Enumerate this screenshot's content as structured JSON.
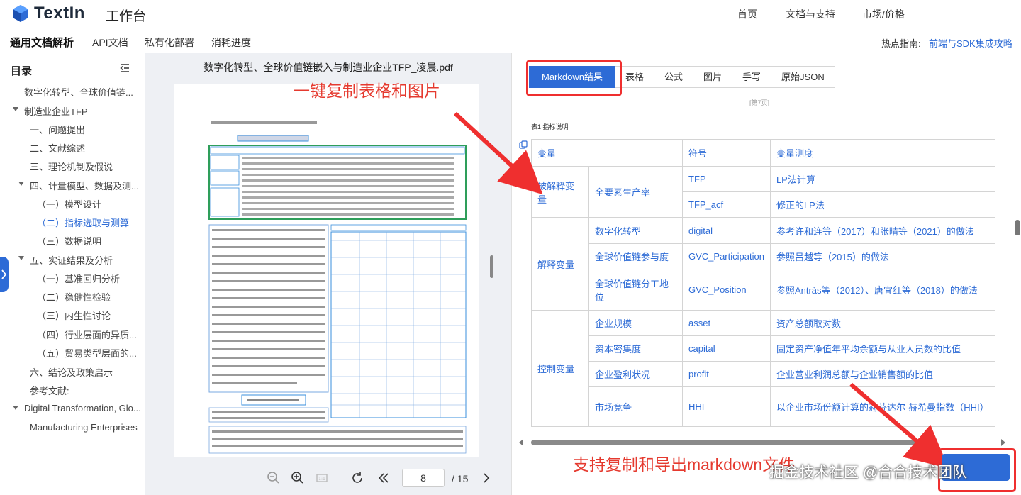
{
  "brand": {
    "name": "TextIn",
    "workbench": "工作台"
  },
  "topnav": {
    "home": "首页",
    "docs": "文档与支持",
    "market": "市场/价格"
  },
  "subnav": {
    "items": [
      "通用文档解析",
      "API文档",
      "私有化部署",
      "消耗进度"
    ],
    "hot_label": "热点指南:",
    "hot_link": "前端与SDK集成攻略"
  },
  "toc": {
    "title": "目录",
    "items": [
      {
        "label": "数字化转型、全球价值链..."
      },
      {
        "label": "制造业企业TFP"
      },
      {
        "label": "一、问题提出"
      },
      {
        "label": "二、文献综述"
      },
      {
        "label": "三、理论机制及假说"
      },
      {
        "label": "四、计量模型、数据及测..."
      },
      {
        "label": "（一）模型设计"
      },
      {
        "label": "（二）指标选取与测算"
      },
      {
        "label": "（三）数据说明"
      },
      {
        "label": "五、实证结果及分析"
      },
      {
        "label": "（一）基准回归分析"
      },
      {
        "label": "（二）稳健性检验"
      },
      {
        "label": "（三）内生性讨论"
      },
      {
        "label": "（四）行业层面的异质..."
      },
      {
        "label": "（五）贸易类型层面的..."
      },
      {
        "label": "六、结论及政策启示"
      },
      {
        "label": "参考文献:"
      },
      {
        "label": "Digital Transformation, Glo..."
      },
      {
        "label": "Manufacturing Enterprises"
      }
    ]
  },
  "pdf": {
    "filename": "数字化转型、全球价值链嵌入与制造业企业TFP_凌晨.pdf",
    "current_page": "8",
    "total_pages": "/ 15"
  },
  "result": {
    "tabs": [
      "Markdown结果",
      "表格",
      "公式",
      "图片",
      "手写",
      "原始JSON"
    ],
    "page_marker": "[第7页]",
    "table_caption": "表1 指标说明",
    "table": {
      "headers": [
        "变量",
        "符号",
        "变量测度"
      ],
      "rows": [
        {
          "group": "被解释变量",
          "name": "全要素生产率",
          "symbol": "TFP",
          "measure": "LP法计算"
        },
        {
          "symbol": "TFP_acf",
          "measure": "修正的LP法"
        },
        {
          "group": "解释变量",
          "name": "数字化转型",
          "symbol": "digital",
          "measure": "参考许和连等（2017）和张晴等（2021）的做法"
        },
        {
          "name": "全球价值链参与度",
          "symbol": "GVC_Participation",
          "measure": "参照吕越等（2015）的做法"
        },
        {
          "name": "全球价值链分工地位",
          "symbol": "GVC_Position",
          "measure": "参照Antràs等（2012）、唐宜红等（2018）的做法"
        },
        {
          "group": "控制变量",
          "name": "企业规模",
          "symbol": "asset",
          "measure": "资产总额取对数"
        },
        {
          "name": "资本密集度",
          "symbol": "capital",
          "measure": "固定资产净值年平均余额与从业人员数的比值"
        },
        {
          "name": "企业盈利状况",
          "symbol": "profit",
          "measure": "企业营业利润总额与企业销售额的比值"
        },
        {
          "name": "市场竞争",
          "symbol": "HHI",
          "measure": "以企业市场份额计算的赫芬达尔-赫希曼指数（HHI）"
        }
      ]
    }
  },
  "annotations": {
    "top": "一键复制表格和图片",
    "bottom": "支持复制和导出markdown文件"
  },
  "watermark": "掘金技术社区 @合合技术团队",
  "colors": {
    "accent": "#2d6bd6",
    "annotation": "#e53a2f"
  }
}
